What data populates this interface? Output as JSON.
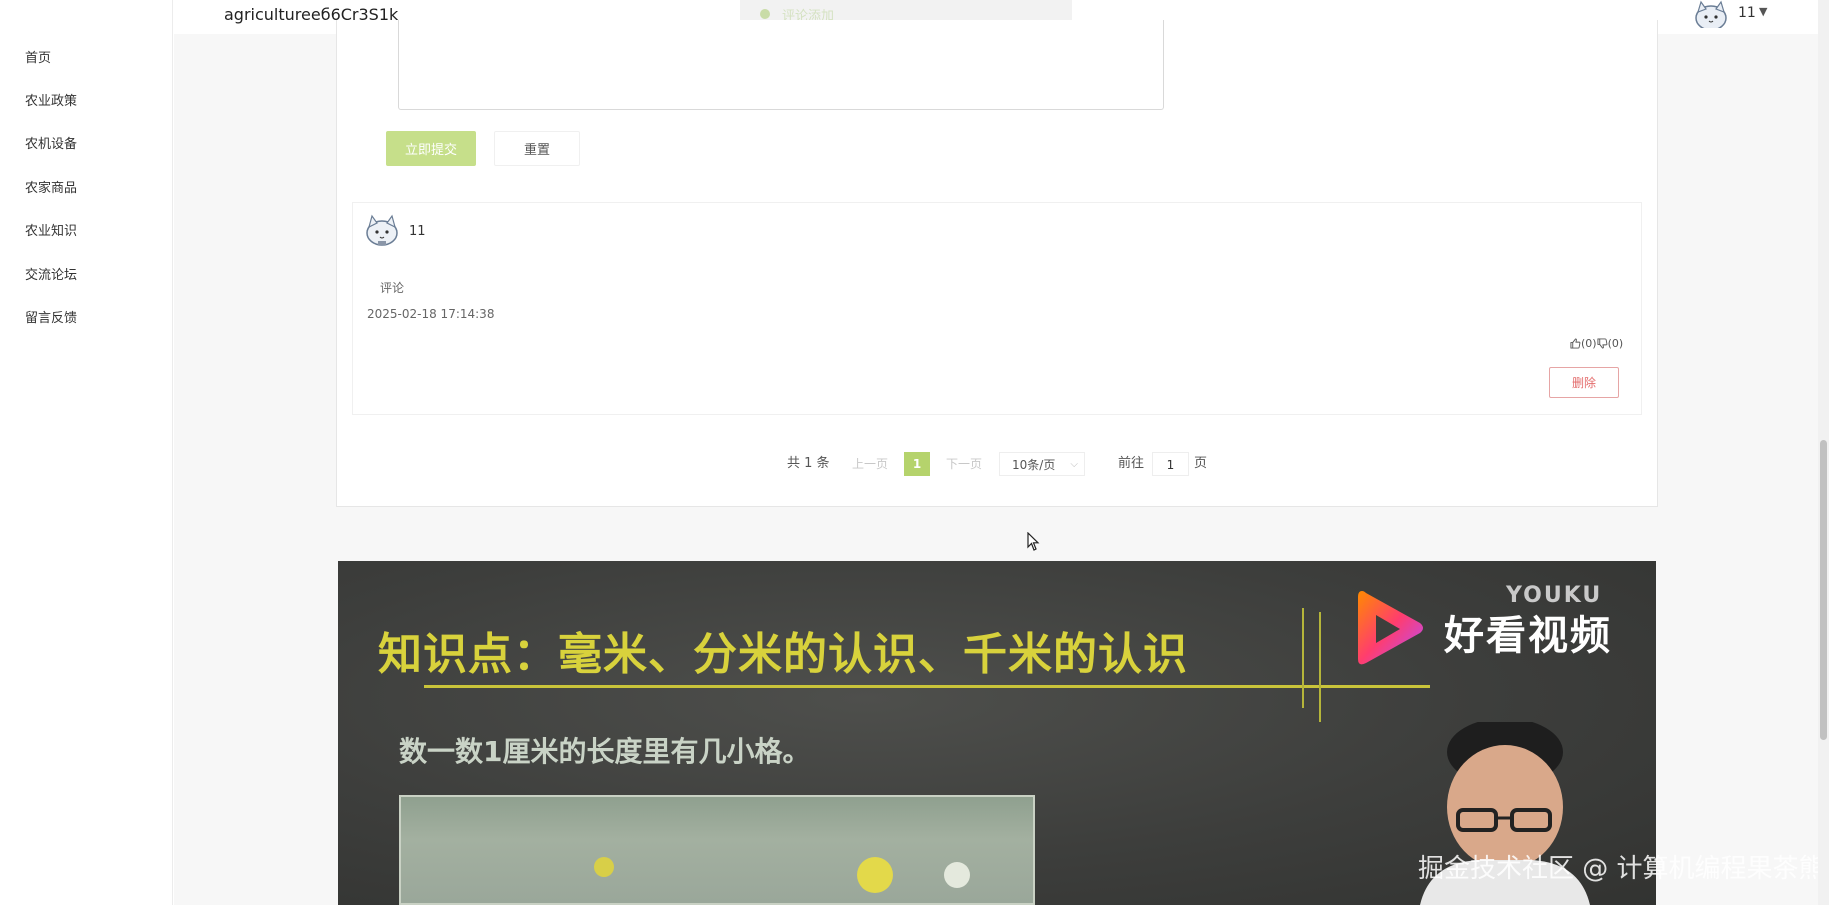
{
  "sidebar": {
    "items": [
      {
        "label": "首页"
      },
      {
        "label": "农业政策"
      },
      {
        "label": "农机设备"
      },
      {
        "label": "农家商品"
      },
      {
        "label": "农业知识"
      },
      {
        "label": "交流论坛"
      },
      {
        "label": "留言反馈"
      }
    ]
  },
  "header": {
    "site_title": "agricultureeб6Cr3S1k",
    "toast": "评论添加",
    "user_name": "11",
    "caret": "▼"
  },
  "form": {
    "submit_label": "立即提交",
    "reset_label": "重置"
  },
  "comment": {
    "user": "11",
    "text": "评论",
    "date": "2025-02-18 17:14:38",
    "likes": "(0)",
    "dislikes": "(0)",
    "delete_label": "删除"
  },
  "pagination": {
    "total": "共 1 条",
    "prev": "上一页",
    "current": "1",
    "next": "下一页",
    "page_size": "10条/页",
    "goto": "前往",
    "goto_value": "1",
    "unit": "页"
  },
  "video": {
    "youku": "YOUKU",
    "brand": "好看视频",
    "title": "知识点：毫米、分米的认识、千米的认识",
    "question": "数一数1厘米的长度里有几小格。",
    "watermark": "掘金技术社区 @ 计算机编程果茶熊"
  },
  "colors": {
    "accent_green": "#c6df8a",
    "page_active": "#b5d36c",
    "delete_red": "#e36b6b"
  }
}
